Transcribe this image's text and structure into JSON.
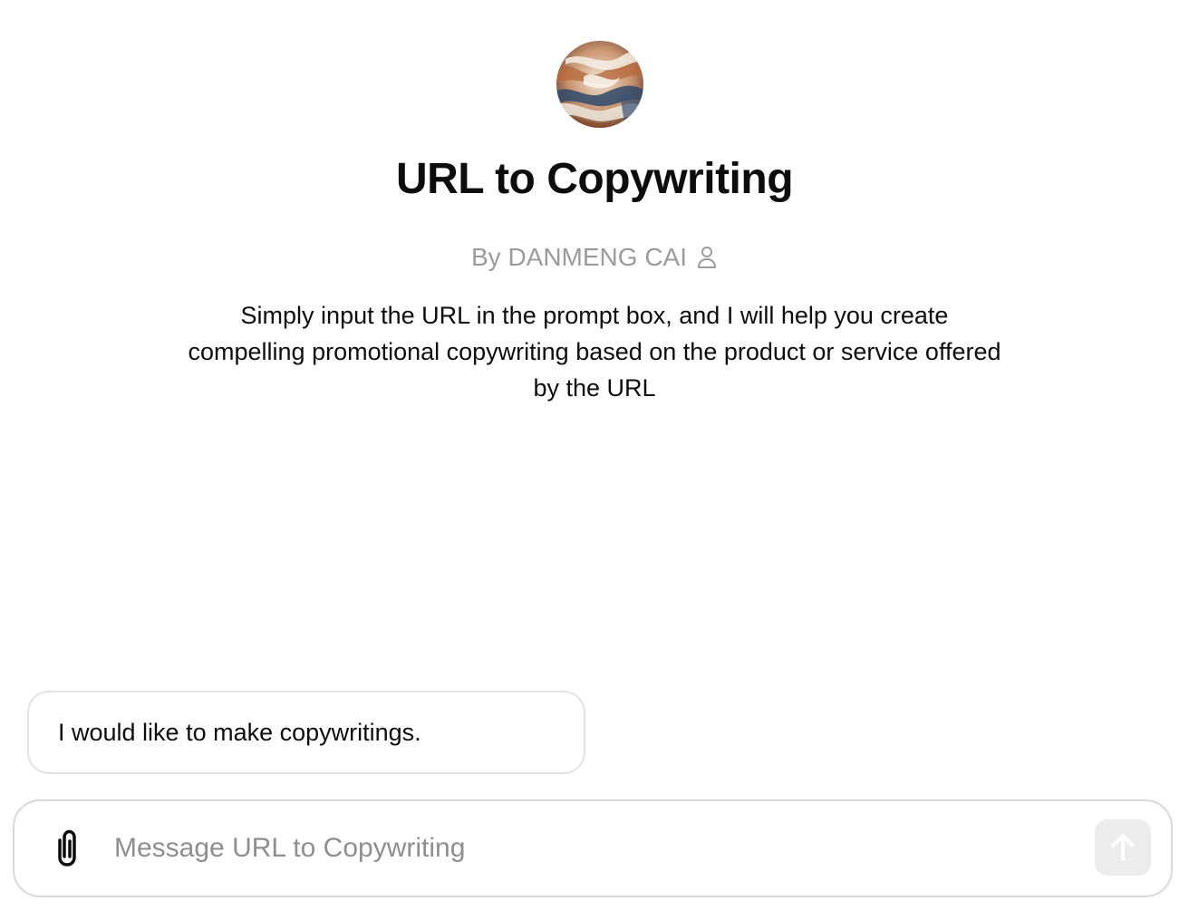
{
  "gpt": {
    "title": "URL to Copywriting",
    "byline": "By DANMENG CAI",
    "description": "Simply input the URL in the prompt box, and I will help you create compelling promotional copywriting based on the product or service offered by the URL"
  },
  "conversation_starters": [
    {
      "label": "I would like to make copywritings."
    }
  ],
  "composer": {
    "placeholder": "Message URL to Copywriting",
    "value": "",
    "attach_icon": "paperclip-icon",
    "send_icon": "arrow-up-icon"
  },
  "colors": {
    "text": "#0d0d0d",
    "muted": "#9b9b9b",
    "border": "#e3e3e3",
    "send_disabled_bg": "#ececec"
  }
}
